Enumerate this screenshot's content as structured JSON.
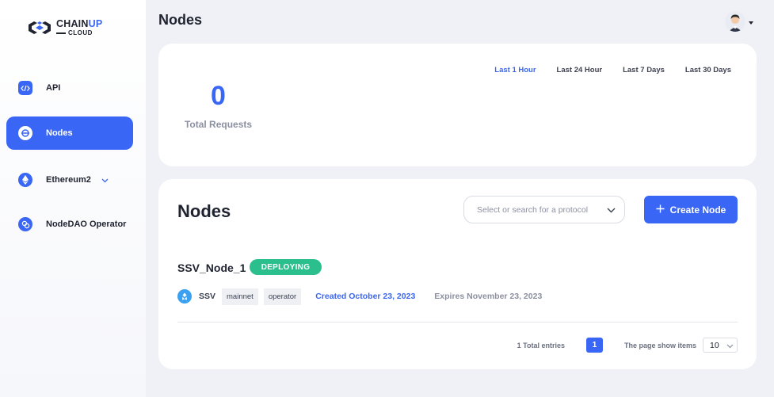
{
  "app": {
    "logo_main_a": "CHAIN",
    "logo_main_b": "UP",
    "logo_sub": "CLOUD",
    "brand_color": "#3a66f5"
  },
  "sidebar": {
    "items": [
      {
        "label": "API",
        "icon": "code-icon"
      },
      {
        "label": "Nodes",
        "icon": "node-icon",
        "active": true
      },
      {
        "label": "Ethereum2",
        "icon": "ethereum-icon",
        "expandable": true
      },
      {
        "label": "NodeDAO Operator",
        "icon": "nodedao-icon"
      }
    ]
  },
  "header": {
    "title": "Nodes"
  },
  "stats": {
    "total_requests_value": "0",
    "total_requests_label": "Total Requests",
    "ranges": [
      "Last 1 Hour",
      "Last 24 Hour",
      "Last 7 Days",
      "Last 30 Days"
    ],
    "active_range": "Last 1 Hour"
  },
  "nodes": {
    "title": "Nodes",
    "protocol_placeholder": "Select or search for a protocol",
    "create_label": "Create Node",
    "list": [
      {
        "name": "SSV_Node_1",
        "status": "DEPLOYING",
        "protocol": "SSV",
        "tags": [
          "mainnet",
          "operator"
        ],
        "created": "Created October 23, 2023",
        "expires": "Expires November 23, 2023"
      }
    ],
    "pagination": {
      "total": "1 Total entries",
      "current_page": "1",
      "show_label": "The page show items",
      "page_size": "10"
    }
  }
}
